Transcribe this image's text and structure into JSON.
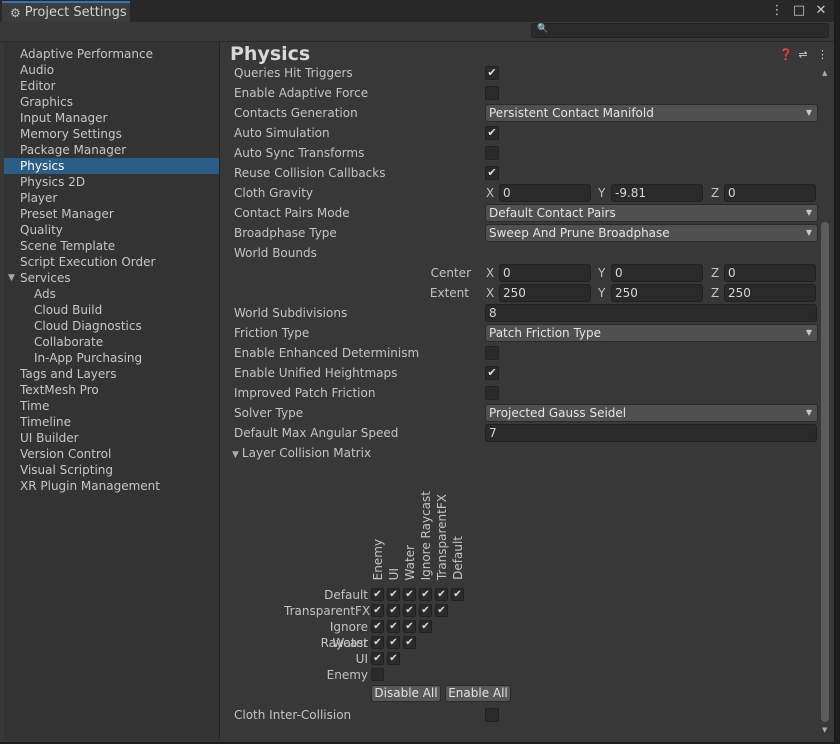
{
  "window": {
    "tab_title": "Project Settings"
  },
  "search": {
    "placeholder": ""
  },
  "sidebar": {
    "items": [
      "Adaptive Performance",
      "Audio",
      "Editor",
      "Graphics",
      "Input Manager",
      "Memory Settings",
      "Package Manager",
      "Physics",
      "Physics 2D",
      "Player",
      "Preset Manager",
      "Quality",
      "Scene Template",
      "Script Execution Order",
      "Services",
      "Ads",
      "Cloud Build",
      "Cloud Diagnostics",
      "Collaborate",
      "In-App Purchasing",
      "Tags and Layers",
      "TextMesh Pro",
      "Time",
      "Timeline",
      "UI Builder",
      "Version Control",
      "Visual Scripting",
      "XR Plugin Management"
    ],
    "selected": "Physics"
  },
  "physics": {
    "title": "Physics",
    "queries_hit_triggers": {
      "label": "Queries Hit Triggers",
      "checked": true
    },
    "enable_adaptive_force": {
      "label": "Enable Adaptive Force",
      "checked": false
    },
    "contacts_generation": {
      "label": "Contacts Generation",
      "value": "Persistent Contact Manifold"
    },
    "auto_simulation": {
      "label": "Auto Simulation",
      "checked": true
    },
    "auto_sync_transforms": {
      "label": "Auto Sync Transforms",
      "checked": false
    },
    "reuse_collision_callbacks": {
      "label": "Reuse Collision Callbacks",
      "checked": true
    },
    "cloth_gravity": {
      "label": "Cloth Gravity",
      "x": "0",
      "y": "-9.81",
      "z": "0"
    },
    "contact_pairs_mode": {
      "label": "Contact Pairs Mode",
      "value": "Default Contact Pairs"
    },
    "broadphase_type": {
      "label": "Broadphase Type",
      "value": "Sweep And Prune Broadphase"
    },
    "world_bounds": {
      "label": "World Bounds",
      "center": {
        "label": "Center",
        "x": "0",
        "y": "0",
        "z": "0"
      },
      "extent": {
        "label": "Extent",
        "x": "250",
        "y": "250",
        "z": "250"
      }
    },
    "world_subdivisions": {
      "label": "World Subdivisions",
      "value": "8"
    },
    "friction_type": {
      "label": "Friction Type",
      "value": "Patch Friction Type"
    },
    "enable_enhanced_determinism": {
      "label": "Enable Enhanced Determinism",
      "checked": false
    },
    "enable_unified_heightmaps": {
      "label": "Enable Unified Heightmaps",
      "checked": true
    },
    "improved_patch_friction": {
      "label": "Improved Patch Friction",
      "checked": false
    },
    "solver_type": {
      "label": "Solver Type",
      "value": "Projected Gauss Seidel"
    },
    "default_max_angular_speed": {
      "label": "Default Max Angular Speed",
      "value": "7"
    },
    "layer_collision_matrix": {
      "label": "Layer Collision Matrix",
      "columns": [
        "Enemy",
        "UI",
        "Water",
        "Ignore Raycast",
        "TransparentFX",
        "Default"
      ],
      "rows": [
        {
          "name": "Default",
          "cells": [
            true,
            true,
            true,
            true,
            true,
            true
          ]
        },
        {
          "name": "TransparentFX",
          "cells": [
            true,
            true,
            true,
            true,
            true
          ]
        },
        {
          "name": "Ignore Raycast",
          "cells": [
            true,
            true,
            true,
            true
          ]
        },
        {
          "name": "Water",
          "cells": [
            true,
            true,
            true
          ]
        },
        {
          "name": "UI",
          "cells": [
            true,
            true
          ]
        },
        {
          "name": "Enemy",
          "cells": [
            false
          ]
        }
      ],
      "disable_all": "Disable All",
      "enable_all": "Enable All"
    },
    "cloth_inter_collision": {
      "label": "Cloth Inter-Collision",
      "checked": false
    },
    "axis_x": "X",
    "axis_y": "Y",
    "axis_z": "Z"
  }
}
